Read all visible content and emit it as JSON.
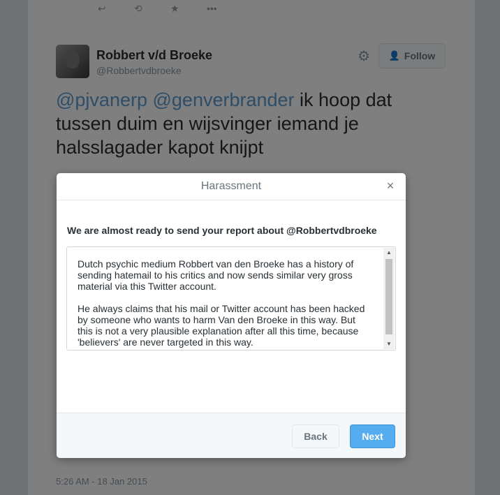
{
  "tweet": {
    "author_name": "Robbert v/d Broeke",
    "author_handle": "@Robbertvdbroeke",
    "follow_label": "Follow",
    "mention_1": "@pjvanerp",
    "mention_2": "@genverbrander",
    "text_rest": " ik hoop dat tussen duim en wijsvinger iemand je halsslagader kapot knijpt",
    "timestamp": "5:26 AM - 18 Jan 2015"
  },
  "modal": {
    "title": "Harassment",
    "heading": "We are almost ready to send your report about @Robbertvdbroeke",
    "report_paragraph_1": "Dutch psychic medium Robbert van den Broeke has a history of sending hatemail to his critics and now sends similar very gross material via this Twitter account.",
    "report_paragraph_2": "He always claims that his mail or Twitter account has been hacked by someone who wants to harm Van den Broeke in this way. But this is not a very plausible explanation after all this time, because 'believers' are never targeted in this way.",
    "back_label": "Back",
    "next_label": "Next"
  },
  "colors": {
    "accent": "#55acee",
    "mention": "#5b9bd1"
  },
  "icons": {
    "close": "close-icon",
    "gear": "gear-icon",
    "follow": "add-user-icon"
  }
}
